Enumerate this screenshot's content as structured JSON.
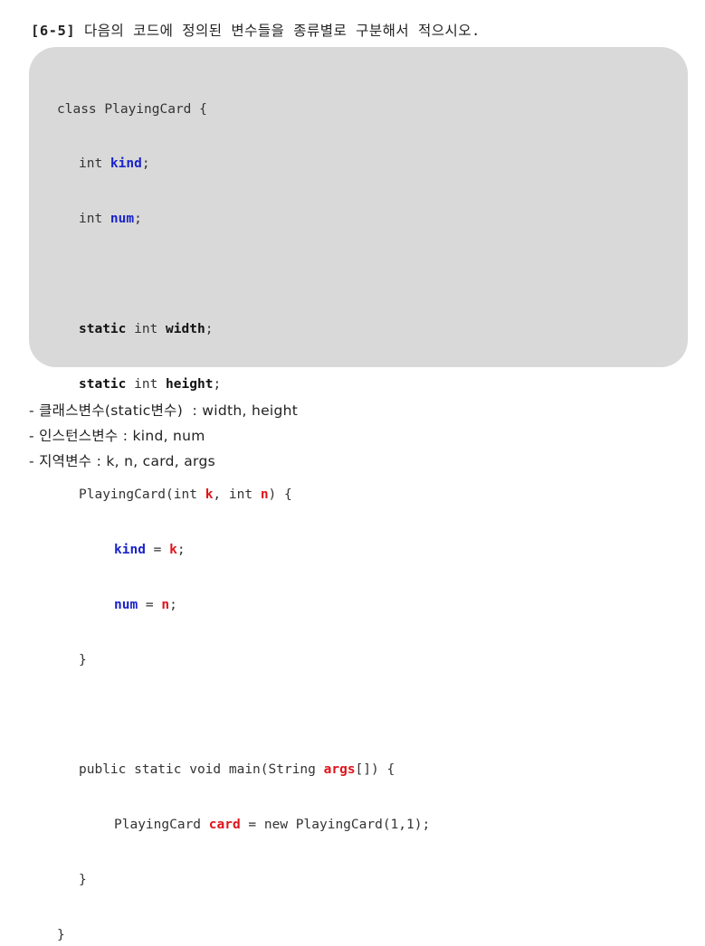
{
  "question": {
    "number": "[6-5]",
    "text": "다음의 코드에 정의된 변수들을 종류별로 구분해서 적으시오."
  },
  "code": {
    "l1": "class PlayingCard {",
    "l2_type": "int ",
    "l2_var": "kind",
    "l2_end": ";",
    "l3_type": "int ",
    "l3_var": "num",
    "l3_end": ";",
    "l5_kw": "static",
    "l5_type": " int ",
    "l5_var": "width",
    "l5_end": ";",
    "l6_kw": "static",
    "l6_type": " int ",
    "l6_var": "height",
    "l6_end": ";",
    "l8_a": "PlayingCard(int ",
    "l8_k": "k",
    "l8_b": ", int ",
    "l8_n": "n",
    "l8_c": ") {",
    "l9_var": "kind",
    "l9_eq": " = ",
    "l9_val": "k",
    "l9_end": ";",
    "l10_var": "num",
    "l10_eq": " = ",
    "l10_val": "n",
    "l10_end": ";",
    "l11": "}",
    "l13_a": "public static void main(String ",
    "l13_args": "args",
    "l13_b": "[]) {",
    "l14_a": "PlayingCard ",
    "l14_card": "card",
    "l14_b": " = new PlayingCard(1,1);",
    "l15": "}",
    "l16": "}"
  },
  "answers": [
    "- 클래스변수(static변수)  : width, height",
    "- 인스턴스변수 : kind, num",
    "- 지역변수 : k, n, card, args"
  ]
}
